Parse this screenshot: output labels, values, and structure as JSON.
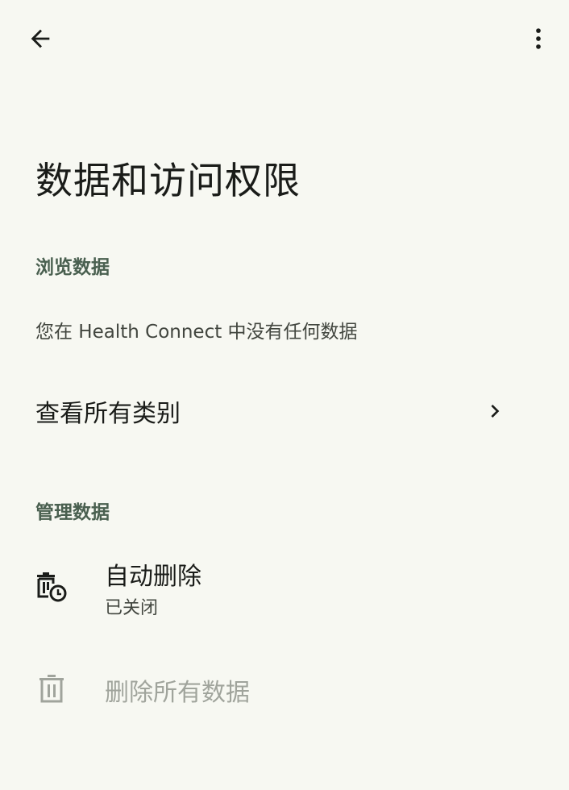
{
  "header": {
    "back_icon": "arrow-back-icon",
    "more_icon": "more-vert-icon"
  },
  "page": {
    "title": "数据和访问权限"
  },
  "browse": {
    "header": "浏览数据",
    "empty_message": "您在 Health Connect 中没有任何数据",
    "view_all_label": "查看所有类别",
    "chevron_icon": "chevron-right-icon"
  },
  "manage": {
    "header": "管理数据",
    "auto_delete": {
      "icon": "auto-delete-icon",
      "title": "自动删除",
      "subtitle": "已关闭"
    },
    "delete_all": {
      "icon": "trash-icon",
      "title": "删除所有数据",
      "disabled": true
    }
  },
  "colors": {
    "background": "#f7f8f2",
    "section_header": "#4a6050",
    "text_primary": "#1a1c19",
    "text_disabled": "#a0a49c"
  }
}
